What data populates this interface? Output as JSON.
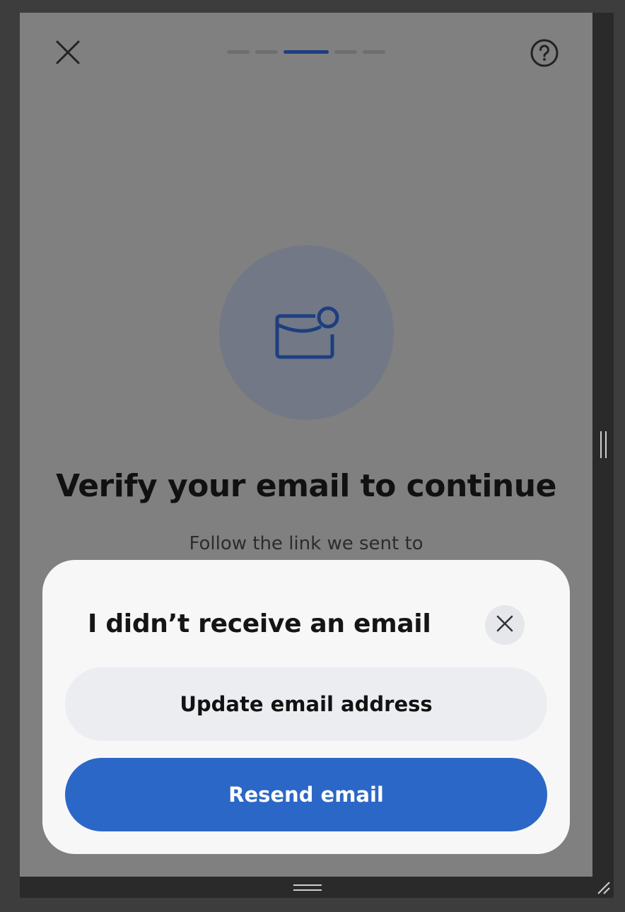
{
  "colors": {
    "overlay_background": "#808080",
    "primary_button": "#2b67c6",
    "secondary_button": "#ecedf1",
    "progress_active": "#1d3f80",
    "icon_color": "#1d3f80"
  },
  "header": {
    "close_icon": "close-icon",
    "help_icon": "question-circle-icon",
    "progress": {
      "total_steps": 5,
      "current_step": 3
    }
  },
  "main": {
    "illustration_icon": "mail-notification-icon",
    "title": "Verify your email to continue",
    "subtitle": "Follow the link we sent to"
  },
  "sheet": {
    "title": "I didn’t receive an email",
    "close_icon": "close-icon",
    "update_button_label": "Update email address",
    "resend_button_label": "Resend email"
  }
}
